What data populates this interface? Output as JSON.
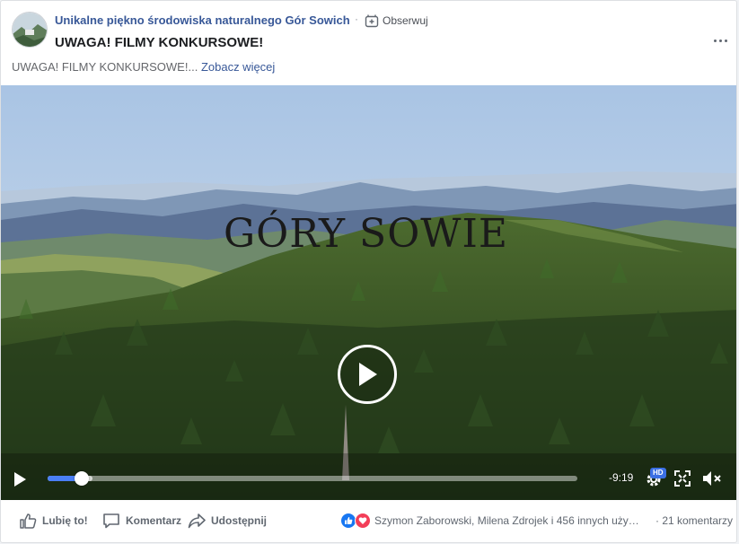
{
  "post": {
    "page_name": "Unikalne piękno środowiska naturalnego Gór Sowich",
    "separator": "·",
    "follow_label": "Obserwuj",
    "title": "UWAGA! FILMY KONKURSOWE!",
    "excerpt_text": "UWAGA! FILMY KONKURSOWE!...",
    "see_more_label": "Zobacz więcej",
    "icons": {
      "avatar": "page-avatar",
      "follow": "follow-icon",
      "more": "more-options-icon"
    }
  },
  "video": {
    "title_overlay": "GÓRY SOWIE",
    "time_remaining": "-9:19",
    "progress": 0.064,
    "buffered": 0.085,
    "hd_label": "HD",
    "icons": {
      "play": "play-icon",
      "settings": "settings-icon",
      "fullscreen": "fullscreen-icon",
      "mute": "muted-speaker-icon"
    }
  },
  "footer": {
    "like_label": "Lubię to!",
    "comment_label": "Komentarz",
    "share_label": "Udostępnij",
    "reactions_text": "Szymon Zaborowski, Milena Zdrojek i 456 innych użyt…",
    "comments_count": "· 21 komentarzy",
    "reaction_icons": [
      "like-reaction-icon",
      "love-reaction-icon"
    ]
  },
  "colors": {
    "link": "#385898",
    "accent": "#4a7ff5",
    "like": "#1877f2",
    "love": "#f33e58"
  }
}
